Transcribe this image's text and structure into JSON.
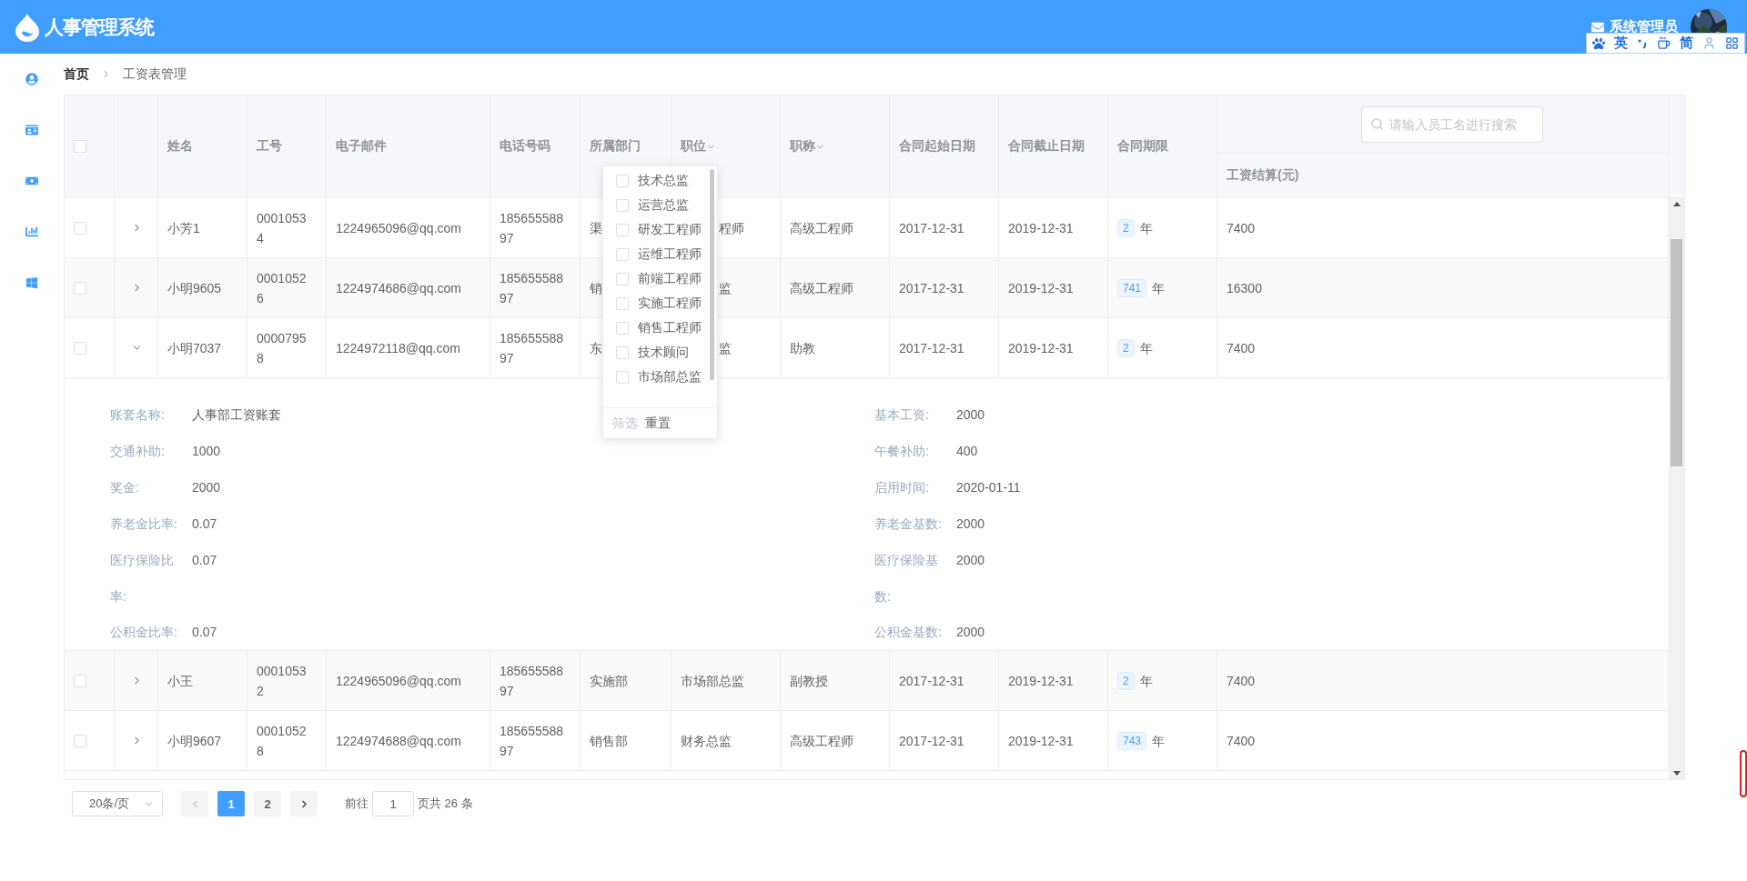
{
  "header": {
    "title": "人事管理系统",
    "user_name": "系统管理员"
  },
  "breadcrumb": [
    {
      "label": "首页",
      "current": false
    },
    {
      "label": "工资表管理",
      "current": true
    }
  ],
  "table": {
    "all_checked": false,
    "columns": [
      {
        "label": "姓名",
        "filter": false
      },
      {
        "label": "工号",
        "filter": false
      },
      {
        "label": "电子邮件",
        "filter": false
      },
      {
        "label": "电话号码",
        "filter": false
      },
      {
        "label": "所属部门",
        "filter": false
      },
      {
        "label": "职位",
        "filter": true
      },
      {
        "label": "职称",
        "filter": true
      },
      {
        "label": "合同起始日期",
        "filter": false
      },
      {
        "label": "合同截止日期",
        "filter": false
      },
      {
        "label": "合同期限",
        "filter": false
      }
    ],
    "search": {
      "placeholder": "请输入员工名进行搜索"
    },
    "salary_column": "工资结算(元)",
    "rows": [
      {
        "checked": false,
        "expanded": false,
        "covered": true,
        "name": "小芳1",
        "id": "00010534",
        "email": "1224965096@qq.com",
        "phone": "18565558897",
        "department": "渠",
        "position": "程师",
        "title": "高级工程师",
        "start": "2017-12-31",
        "end": "2019-12-31",
        "term": "2",
        "term_unit": "年",
        "salary": "7400"
      },
      {
        "checked": false,
        "expanded": false,
        "covered": true,
        "name": "小明9605",
        "id": "00010526",
        "email": "1224974686@qq.com",
        "phone": "18565558897",
        "department": "销",
        "position": "监",
        "title": "高级工程师",
        "start": "2017-12-31",
        "end": "2019-12-31",
        "term": "741",
        "term_unit": "年",
        "salary": "16300"
      },
      {
        "checked": false,
        "expanded": true,
        "covered": true,
        "name": "小明7037",
        "id": "00007958",
        "email": "1224972118@qq.com",
        "phone": "18565558897",
        "department": "东",
        "position": "监",
        "title": "助教",
        "start": "2017-12-31",
        "end": "2019-12-31",
        "term": "2",
        "term_unit": "年",
        "salary": "7400",
        "details": [
          {
            "label": "账套名称:",
            "value": "人事部工资账套"
          },
          {
            "label": "基本工资:",
            "value": "2000"
          },
          {
            "label": "交通补助:",
            "value": "1000"
          },
          {
            "label": "午餐补助:",
            "value": "400"
          },
          {
            "label": "奖金:",
            "value": "2000"
          },
          {
            "label": "启用时间:",
            "value": "2020-01-11"
          },
          {
            "label": "养老金比率:",
            "value": "0.07"
          },
          {
            "label": "养老金基数:",
            "value": "2000"
          },
          {
            "label": "医疗保险比率:",
            "value": "0.07"
          },
          {
            "label": "医疗保险基数:",
            "value": "2000"
          },
          {
            "label": "公积金比率:",
            "value": "0.07"
          },
          {
            "label": "公积金基数:",
            "value": "2000"
          }
        ]
      },
      {
        "checked": false,
        "expanded": false,
        "covered": false,
        "name": "小王",
        "id": "00010532",
        "email": "1224965096@qq.com",
        "phone": "18565558897",
        "department": "实施部",
        "position": "市场部总监",
        "title": "副教授",
        "start": "2017-12-31",
        "end": "2019-12-31",
        "term": "2",
        "term_unit": "年",
        "salary": "7400"
      },
      {
        "checked": false,
        "expanded": false,
        "covered": false,
        "name": "小明9607",
        "id": "00010528",
        "email": "1224974688@qq.com",
        "phone": "18565558897",
        "department": "销售部",
        "position": "财务总监",
        "title": "高级工程师",
        "start": "2017-12-31",
        "end": "2019-12-31",
        "term": "743",
        "term_unit": "年",
        "salary": "7400"
      }
    ]
  },
  "position_filter": {
    "options": [
      {
        "label": "技术总监",
        "checked": false
      },
      {
        "label": "运营总监",
        "checked": false
      },
      {
        "label": "研发工程师",
        "checked": false
      },
      {
        "label": "运维工程师",
        "checked": false
      },
      {
        "label": "前端工程师",
        "checked": false
      },
      {
        "label": "实施工程师",
        "checked": false
      },
      {
        "label": "销售工程师",
        "checked": false
      },
      {
        "label": "技术顾问",
        "checked": false
      },
      {
        "label": "市场部总监",
        "checked": false
      }
    ],
    "confirm": "筛选",
    "confirm_disabled": true,
    "reset": "重置"
  },
  "pagination": {
    "page_size": "20条/页",
    "pages": [
      {
        "label": "1",
        "selected": true
      },
      {
        "label": "2",
        "selected": false
      }
    ],
    "goto_label": "前往",
    "goto_value": "1",
    "total": "页共 26 条"
  },
  "ime_toolbar": {
    "items": [
      "英",
      "简"
    ]
  }
}
